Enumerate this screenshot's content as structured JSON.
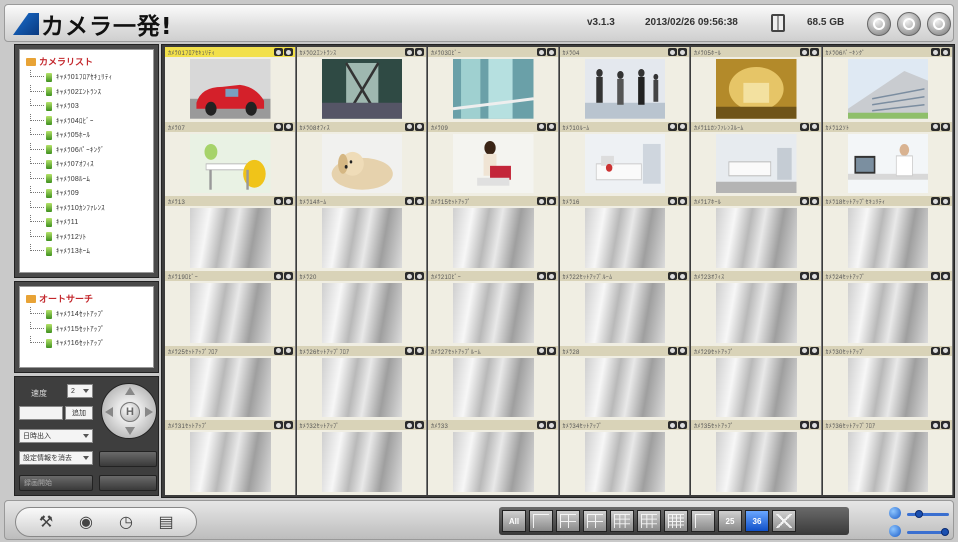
{
  "app": {
    "title": "カメラ一発!",
    "version": "v3.1.3",
    "datetime": "2013/02/26 09:56:38",
    "storage": "68.5 GB"
  },
  "camera_list": {
    "title": "カメラリスト",
    "items": [
      "ｷｬﾒﾗ01ﾌﾛｱｾｷｭﾘﾃｨ",
      "ｷｬﾒﾗ02ｴﾝﾄﾗﾝｽ",
      "ｷｬﾒﾗ03",
      "ｷｬﾒﾗ04ﾛﾋﾞｰ",
      "ｷｬﾒﾗ05ﾎｰﾙ",
      "ｷｬﾒﾗ06ﾊﾟｰｷﾝｸﾞ",
      "ｷｬﾒﾗ07ｵﾌｨｽ",
      "ｷｬﾒﾗ08ﾙｰﾑ",
      "ｷｬﾒﾗ09",
      "ｷｬﾒﾗ10ｶﾝﾌｧﾚﾝｽ",
      "ｷｬﾒﾗ11",
      "ｷｬﾒﾗ12ｿﾄ",
      "ｷｬﾒﾗ13ﾎｰﾑ"
    ]
  },
  "auto_search": {
    "title": "オートサーチ",
    "items": [
      "ｷｬﾒﾗ14ｾｯﾄｱｯﾌﾟ",
      "ｷｬﾒﾗ15ｾｯﾄｱｯﾌﾟ",
      "ｷｬﾒﾗ16ｾｯﾄｱｯﾌﾟ"
    ]
  },
  "controls": {
    "speed_label": "速度",
    "speed_value": "2",
    "add_button": "追加",
    "select_placeholder": "日時出入",
    "preset_select": "設定情報を消去",
    "record_button": "録画開始",
    "btn_a": "",
    "btn_b": "",
    "ptz_home": "H"
  },
  "cameras": [
    {
      "name": "ｶﾒﾗ01ﾌﾛｱｾｷｭﾘﾃｨ",
      "photo": "car",
      "selected": true
    },
    {
      "name": "ｶﾒﾗ02ｴﾝﾄﾗﾝｽ",
      "photo": "door"
    },
    {
      "name": "ｶﾒﾗ03ﾛﾋﾞｰ",
      "photo": "glass"
    },
    {
      "name": "ｶﾒﾗ04",
      "photo": "people"
    },
    {
      "name": "ｶﾒﾗ05ﾎｰﾙ",
      "photo": "hall"
    },
    {
      "name": "ｶﾒﾗ06ﾊﾟｰｷﾝｸﾞ",
      "photo": "building"
    },
    {
      "name": "ｶﾒﾗ07",
      "photo": "chairs"
    },
    {
      "name": "ｶﾒﾗ08ｵﾌｨｽ",
      "photo": "dog"
    },
    {
      "name": "ｶﾒﾗ09",
      "photo": "woman"
    },
    {
      "name": "ｶﾒﾗ10ﾙｰﾑ",
      "photo": "sofa"
    },
    {
      "name": "ｶﾒﾗ11ｶﾝﾌｧﾚﾝｽﾙｰﾑ",
      "photo": "room"
    },
    {
      "name": "ｶﾒﾗ12ｿﾄ",
      "photo": "desk"
    },
    {
      "name": "ｶﾒﾗ13"
    },
    {
      "name": "ｶﾒﾗ14ﾎｰﾑ"
    },
    {
      "name": "ｶﾒﾗ15ｾｯﾄｱｯﾌﾟ"
    },
    {
      "name": "ｶﾒﾗ16"
    },
    {
      "name": "ｶﾒﾗ17ﾎｰﾙ"
    },
    {
      "name": "ｶﾒﾗ18ｾｯﾄｱｯﾌﾟｾｷｭﾘﾃｨ"
    },
    {
      "name": "ｶﾒﾗ19ﾛﾋﾞｰ"
    },
    {
      "name": "ｶﾒﾗ20"
    },
    {
      "name": "ｶﾒﾗ21ﾛﾋﾞｰ"
    },
    {
      "name": "ｶﾒﾗ22ｾｯﾄｱｯﾌﾟﾙｰﾑ"
    },
    {
      "name": "ｶﾒﾗ23ｵﾌｨｽ"
    },
    {
      "name": "ｶﾒﾗ24ｾｯﾄｱｯﾌﾟ"
    },
    {
      "name": "ｶﾒﾗ25ｾｯﾄｱｯﾌﾟﾌﾛｱ"
    },
    {
      "name": "ｶﾒﾗ26ｾｯﾄｱｯﾌﾟﾌﾛｱ"
    },
    {
      "name": "ｶﾒﾗ27ｾｯﾄｱｯﾌﾟﾙｰﾑ"
    },
    {
      "name": "ｶﾒﾗ28"
    },
    {
      "name": "ｶﾒﾗ29ｾｯﾄｱｯﾌﾟ"
    },
    {
      "name": "ｶﾒﾗ30ｾｯﾄｱｯﾌﾟ"
    },
    {
      "name": "ｶﾒﾗ31ｾｯﾄｱｯﾌﾟ"
    },
    {
      "name": "ｶﾒﾗ32ｾｯﾄｱｯﾌﾟ"
    },
    {
      "name": "ｶﾒﾗ33"
    },
    {
      "name": "ｶﾒﾗ34ｾｯﾄｱｯﾌﾟ"
    },
    {
      "name": "ｶﾒﾗ35ｾｯﾄｱｯﾌﾟ"
    },
    {
      "name": "ｶﾒﾗ36ｾｯﾄｱｯﾌﾟﾌﾛｱ"
    }
  ],
  "toolbar": {
    "tools": [
      "settings-icon",
      "camera-icon",
      "schedule-icon",
      "log-icon"
    ],
    "layouts": [
      "All",
      "1",
      "4",
      "6",
      "9",
      "10",
      "16",
      "1x1",
      "25",
      "36",
      "auto"
    ],
    "active_layout": "36"
  },
  "colors": {
    "accent": "#1050c8",
    "selected_header": "#f2e04a",
    "header": "#d9d3b8",
    "list_title": "#c3262b"
  }
}
